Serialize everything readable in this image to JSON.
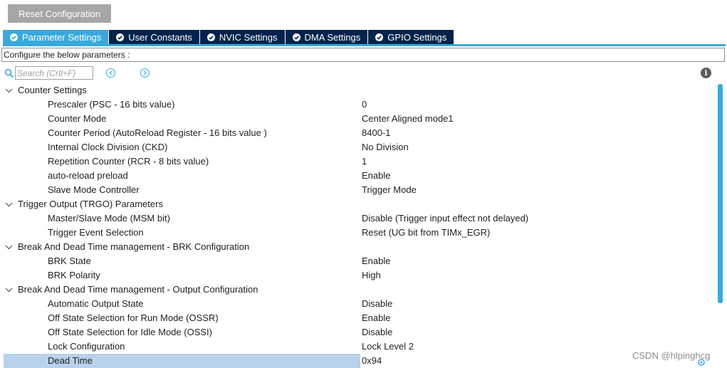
{
  "toolbar": {
    "reset_label": "Reset Configuration"
  },
  "tabs": [
    {
      "label": "Parameter Settings",
      "active": true
    },
    {
      "label": "User Constants",
      "active": false
    },
    {
      "label": "NVIC Settings",
      "active": false
    },
    {
      "label": "DMA Settings",
      "active": false
    },
    {
      "label": "GPIO Settings",
      "active": false
    }
  ],
  "configure_text": "Configure the below parameters :",
  "search": {
    "placeholder": "Search (Crtl+F)"
  },
  "groups": [
    {
      "label": "Counter Settings",
      "params": [
        {
          "name": "Prescaler (PSC - 16 bits value)",
          "value": "0"
        },
        {
          "name": "Counter Mode",
          "value": "Center Aligned mode1"
        },
        {
          "name": "Counter Period (AutoReload Register - 16 bits value )",
          "value": "8400-1"
        },
        {
          "name": "Internal Clock Division (CKD)",
          "value": "No Division"
        },
        {
          "name": "Repetition Counter (RCR - 8 bits value)",
          "value": "1"
        },
        {
          "name": "auto-reload preload",
          "value": "Enable"
        },
        {
          "name": "Slave Mode Controller",
          "value": "Trigger Mode"
        }
      ]
    },
    {
      "label": "Trigger Output (TRGO) Parameters",
      "params": [
        {
          "name": "Master/Slave Mode (MSM bit)",
          "value": "Disable (Trigger input effect not delayed)"
        },
        {
          "name": "Trigger Event Selection",
          "value": "Reset (UG bit from TIMx_EGR)"
        }
      ]
    },
    {
      "label": "Break And Dead Time management - BRK Configuration",
      "params": [
        {
          "name": "BRK State",
          "value": "Enable"
        },
        {
          "name": "BRK Polarity",
          "value": "High"
        }
      ]
    },
    {
      "label": "Break And Dead Time management - Output Configuration",
      "params": [
        {
          "name": "Automatic Output State",
          "value": "Disable"
        },
        {
          "name": "Off State Selection for Run Mode (OSSR)",
          "value": "Enable"
        },
        {
          "name": "Off State Selection for Idle Mode (OSSI)",
          "value": "Disable"
        },
        {
          "name": "Lock Configuration",
          "value": "Lock Level 2"
        },
        {
          "name": "Dead Time",
          "value": "0x94",
          "selected": true
        }
      ]
    }
  ],
  "watermark": "CSDN @hlpinghcg",
  "colors": {
    "accent": "#39a9dc",
    "tab_dark": "#03234b",
    "selection": "#b9d1ea"
  },
  "icons": {
    "tab": "check-circle-icon",
    "search": "search-icon",
    "prev": "chevron-left-circle-icon",
    "next": "chevron-right-circle-icon",
    "info": "info-icon",
    "caret": "chevron-down-icon"
  }
}
